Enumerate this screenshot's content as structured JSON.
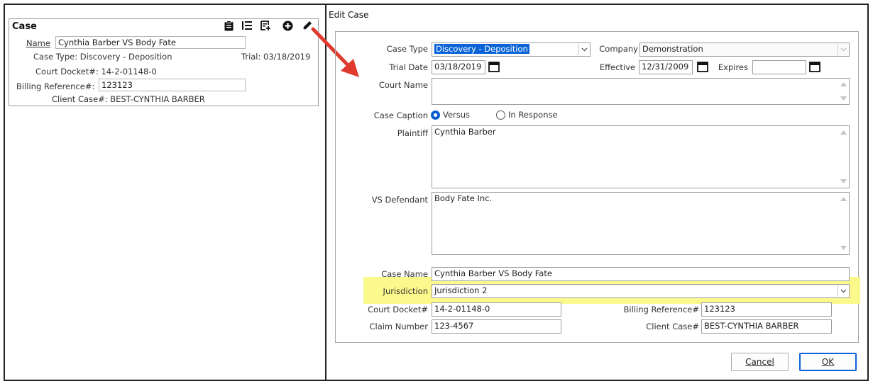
{
  "left_card": {
    "title": "Case",
    "name_label": "Name",
    "name_value": "Cynthia Barber VS Body Fate",
    "case_type": "Case Type: Discovery - Deposition",
    "trial": "Trial: 03/18/2019",
    "court_docket": "Court Docket#: 14-2-01148-0",
    "billing_label": "Billing Reference#:",
    "billing_value": "123123",
    "client_case": "Client Case#: BEST-CYNTHIA BARBER",
    "icons": [
      "clipboard-icon",
      "list-icon",
      "add-note-icon",
      "plus-circle-icon",
      "pencil-icon"
    ]
  },
  "dialog": {
    "title": "Edit Case",
    "case_type_label": "Case Type",
    "case_type_value": "Discovery - Deposition",
    "company_label": "Company",
    "company_value": "Demonstration",
    "trial_date_label": "Trial Date",
    "trial_date_value": "03/18/2019",
    "effective_label": "Effective",
    "effective_value": "12/31/2009",
    "expires_label": "Expires",
    "expires_value": "",
    "court_name_label": "Court Name",
    "court_name_value": "",
    "caption_label": "Case Caption",
    "caption_options": [
      "Versus",
      "In Response"
    ],
    "caption_selected": "Versus",
    "plaintiff_label": "Plaintiff",
    "plaintiff_value": "Cynthia Barber",
    "defendant_label": "VS Defendant",
    "defendant_value": "Body Fate Inc.",
    "case_name_label": "Case Name",
    "case_name_value": "Cynthia Barber VS Body Fate",
    "jurisdiction_label": "Jurisdiction",
    "jurisdiction_value": "Jurisdiction 2",
    "court_docket_label": "Court Docket#",
    "court_docket_value": "14-2-01148-0",
    "billing_label": "Billing Reference#",
    "billing_value": "123123",
    "claim_label": "Claim Number",
    "claim_value": "123-4567",
    "client_case_label": "Client Case#",
    "client_case_value": "BEST-CYNTHIA BARBER",
    "cancel_label": "Cancel",
    "ok_label": "OK"
  },
  "colors": {
    "selection": "#0a64d8",
    "highlight": "#fcf98c",
    "arrow": "#e03a2f"
  }
}
